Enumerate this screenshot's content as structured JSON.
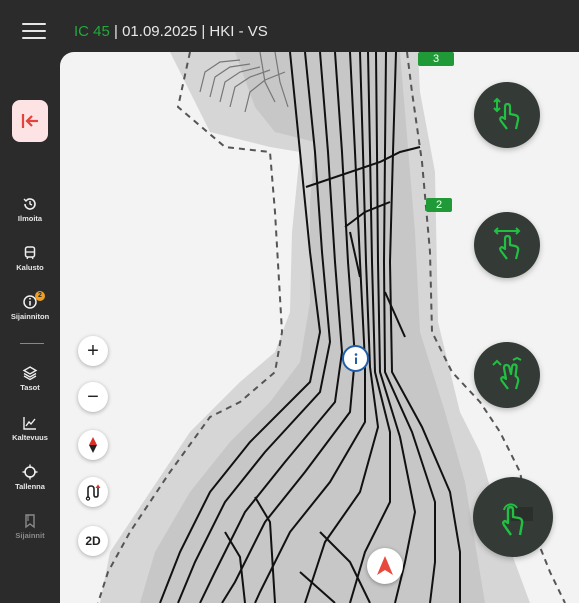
{
  "header": {
    "train_id": "IC 45",
    "trip_info": " | 01.09.2025 | HKI - VS"
  },
  "sidebar": {
    "items": [
      {
        "label": "Ilmoita",
        "icon": "history-icon"
      },
      {
        "label": "Kalusto",
        "icon": "train-icon"
      },
      {
        "label": "Sijainniton",
        "icon": "info-icon",
        "badge": "2"
      },
      {
        "label": "Tasot",
        "icon": "layers-icon"
      },
      {
        "label": "Kaltevuus",
        "icon": "chart-icon"
      },
      {
        "label": "Tallenna",
        "icon": "crosshair-icon"
      },
      {
        "label": "Sijainnit",
        "icon": "bookmark-icon"
      }
    ]
  },
  "map": {
    "km_markers": [
      "3",
      "2"
    ],
    "controls": {
      "zoom_in": "+",
      "zoom_out": "−",
      "view_mode": "2D"
    }
  },
  "colors": {
    "accent_green": "#22a83b",
    "exit_red": "#e0443c",
    "marker_blue": "#1e5fa8"
  }
}
